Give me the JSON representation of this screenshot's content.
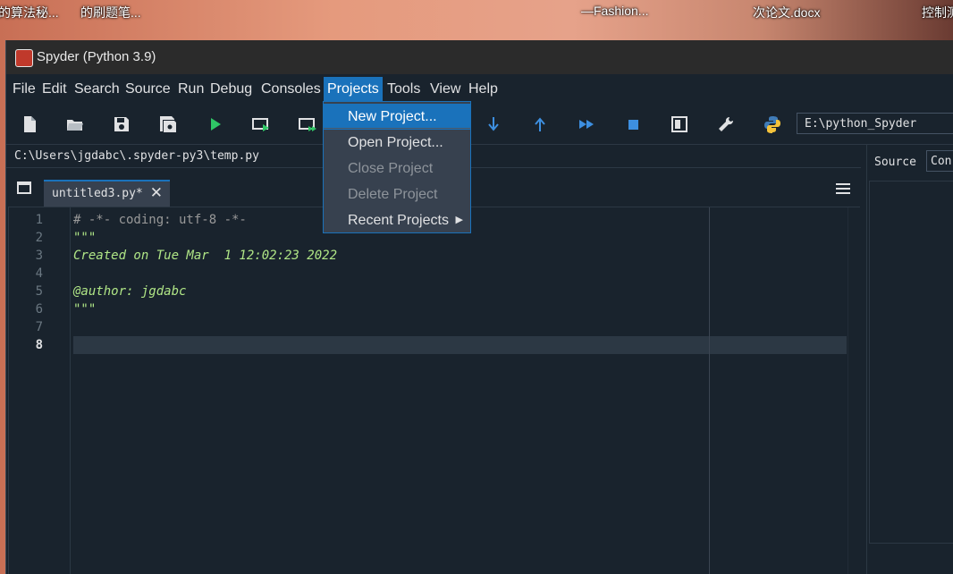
{
  "desktop": {
    "labels": [
      "的算法秘...",
      "的刷题笔...",
      "—Fashion...",
      "次论文.docx",
      "控制测"
    ]
  },
  "window": {
    "title": "Spyder (Python 3.9)"
  },
  "menu": {
    "items": [
      "File",
      "Edit",
      "Search",
      "Source",
      "Run",
      "Debug",
      "Consoles",
      "Projects",
      "Tools",
      "View",
      "Help"
    ],
    "active": "Projects"
  },
  "toolbar": {
    "icons": [
      "new-file-icon",
      "open-file-icon",
      "save-icon",
      "save-all-icon",
      "run-icon",
      "run-cell-icon",
      "run-cell-advance-icon",
      "step-into-icon",
      "step-return-icon",
      "continue-icon",
      "stop-icon",
      "maximize-pane-icon",
      "preferences-wrench-icon",
      "python-path-icon"
    ],
    "working_dir": "E:\\python_Spyder"
  },
  "editor": {
    "file_path": "C:\\Users\\jgdabc\\.spyder-py3\\temp.py",
    "tab_label": "untitled3.py*",
    "tab_close": "✕",
    "line_numbers": [
      "1",
      "2",
      "3",
      "4",
      "5",
      "6",
      "7",
      "8"
    ],
    "current_line": "8",
    "lines": [
      "# -*- coding: utf-8 -*-",
      "\"\"\"",
      "Created on Tue Mar  1 12:02:23 2022",
      "",
      "@author: jgdabc",
      "\"\"\"",
      "",
      ""
    ]
  },
  "right_pane": {
    "source_label": "Source",
    "combo_value": "Con"
  },
  "projects_menu": {
    "items": [
      {
        "label": "New Project...",
        "state": "highlighted"
      },
      {
        "label": "Open Project...",
        "state": "enabled"
      },
      {
        "label": "Close Project",
        "state": "disabled"
      },
      {
        "label": "Delete Project",
        "state": "disabled"
      },
      {
        "label": "Recent Projects",
        "state": "submenu"
      }
    ]
  },
  "colors": {
    "accent": "#1a72bb",
    "background": "#19232d",
    "docstring": "#b0e686",
    "comment": "#999999"
  }
}
